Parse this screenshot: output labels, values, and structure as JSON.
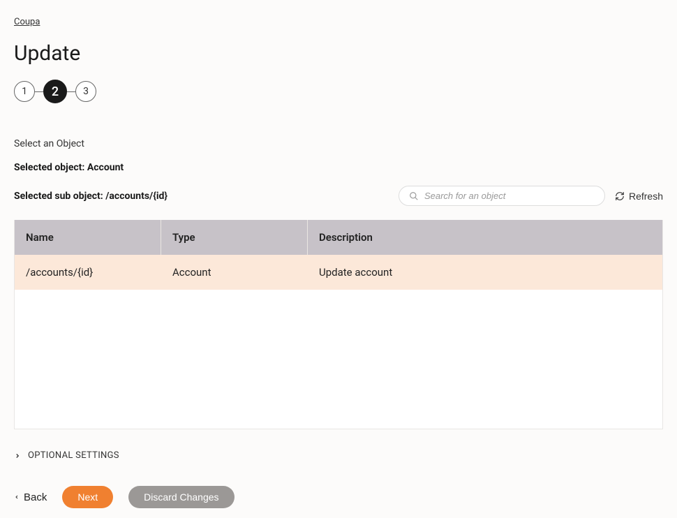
{
  "breadcrumb": {
    "label": "Coupa"
  },
  "page": {
    "title": "Update"
  },
  "stepper": {
    "steps": [
      {
        "label": "1",
        "active": false
      },
      {
        "label": "2",
        "active": true
      },
      {
        "label": "3",
        "active": false
      }
    ]
  },
  "section": {
    "select_label": "Select an Object",
    "selected_object": "Selected object: Account",
    "selected_sub_object": "Selected sub object: /accounts/{id}"
  },
  "search": {
    "placeholder": "Search for an object"
  },
  "refresh": {
    "label": "Refresh"
  },
  "table": {
    "headers": {
      "name": "Name",
      "type": "Type",
      "description": "Description"
    },
    "rows": [
      {
        "name": "/accounts/{id}",
        "type": "Account",
        "description": "Update account"
      }
    ]
  },
  "optional_settings": {
    "label": "OPTIONAL SETTINGS"
  },
  "footer": {
    "back": "Back",
    "next": "Next",
    "discard": "Discard Changes"
  }
}
